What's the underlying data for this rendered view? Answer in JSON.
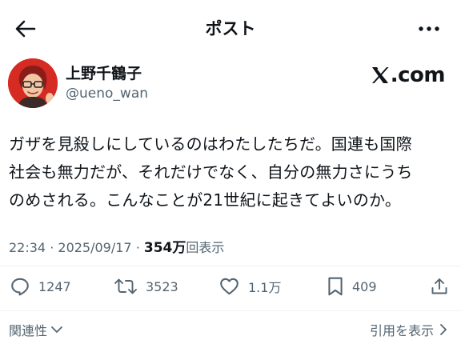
{
  "header": {
    "title": "ポスト",
    "back_icon": "arrow-left-icon",
    "more_icon": "more-horizontal-icon"
  },
  "author": {
    "name": "上野千鶴子",
    "handle": "@ueno_wan",
    "brand": "X.com"
  },
  "post": {
    "lines": [
      "ガザを見殺しにしているのはわたしたちだ。国連も国際",
      "社会も無力だが、それだけでなく、自分の無力さにうち",
      "のめされる。こんなことが21世紀に起きてよいのか。"
    ]
  },
  "meta": {
    "time": "22:34",
    "separator": "·",
    "date": "2025/09/17",
    "views_count": "354万",
    "views_label": "回表示"
  },
  "actions": {
    "replies": "1247",
    "reposts": "3523",
    "likes": "1.1万",
    "bookmarks": "409"
  },
  "footer": {
    "related_label": "関連性",
    "quotes_label": "引用を表示"
  },
  "colors": {
    "text": "#0f1419",
    "secondary": "#536471",
    "divider": "#eff3f4",
    "avatar_bg": "#d62b22"
  }
}
